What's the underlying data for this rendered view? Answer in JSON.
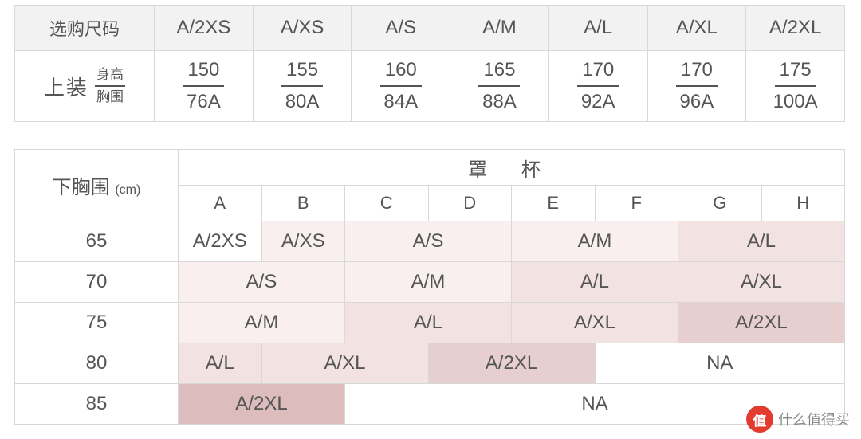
{
  "table1": {
    "header_first": "选购尺码",
    "sizes": [
      "A/2XS",
      "A/XS",
      "A/S",
      "A/M",
      "A/L",
      "A/XL",
      "A/2XL"
    ],
    "row_label_main": "上装",
    "row_label_sub1": "身高",
    "row_label_sub2": "胸围",
    "heights": [
      "150",
      "155",
      "160",
      "165",
      "170",
      "170",
      "175"
    ],
    "busts": [
      "76A",
      "80A",
      "84A",
      "88A",
      "92A",
      "96A",
      "100A"
    ]
  },
  "table2": {
    "row_header_label": "下胸围",
    "row_header_unit": "(cm)",
    "cup_title": "罩 杯",
    "cup_letters": [
      "A",
      "B",
      "C",
      "D",
      "E",
      "F",
      "G",
      "H"
    ],
    "row65": {
      "label": "65",
      "c0": "A/2XS",
      "c1": "A/XS",
      "c2": "A/S",
      "c3": "A/M",
      "c4": "A/L"
    },
    "row70": {
      "label": "70",
      "c0": "A/S",
      "c1": "A/M",
      "c2": "A/L",
      "c3": "A/XL"
    },
    "row75": {
      "label": "75",
      "c0": "A/M",
      "c1": "A/L",
      "c2": "A/XL",
      "c3": "A/2XL"
    },
    "row80": {
      "label": "80",
      "c0": "A/L",
      "c1": "A/XL",
      "c2": "A/2XL",
      "c3": "NA"
    },
    "row85": {
      "label": "85",
      "c0": "A/2XL",
      "c1": "NA"
    }
  },
  "watermark": {
    "badge": "值",
    "text": "什么值得买"
  },
  "chart_data": [
    {
      "type": "table",
      "title": "选购尺码 上装 (身高/胸围)",
      "columns": [
        "选购尺码",
        "A/2XS",
        "A/XS",
        "A/S",
        "A/M",
        "A/L",
        "A/XL",
        "A/2XL"
      ],
      "rows": [
        {
          "metric": "身高",
          "values": [
            150,
            155,
            160,
            165,
            170,
            170,
            175
          ]
        },
        {
          "metric": "胸围",
          "values": [
            "76A",
            "80A",
            "84A",
            "88A",
            "92A",
            "96A",
            "100A"
          ]
        }
      ]
    },
    {
      "type": "table",
      "title": "下胸围(cm) × 罩杯 → 选购尺码",
      "xlabel": "罩杯",
      "ylabel": "下胸围 (cm)",
      "x": [
        "A",
        "B",
        "C",
        "D",
        "E",
        "F",
        "G",
        "H"
      ],
      "y": [
        65,
        70,
        75,
        80,
        85
      ],
      "grid": [
        [
          "A/2XS",
          "A/XS",
          "A/S",
          "A/S",
          "A/M",
          "A/M",
          "A/L",
          "A/L"
        ],
        [
          "A/S",
          "A/S",
          "A/M",
          "A/M",
          "A/L",
          "A/L",
          "A/XL",
          "A/XL"
        ],
        [
          "A/M",
          "A/M",
          "A/L",
          "A/L",
          "A/XL",
          "A/XL",
          "A/2XL",
          "A/2XL"
        ],
        [
          "A/L",
          "A/XL",
          "A/XL",
          "A/2XL",
          "A/2XL",
          "NA",
          "NA",
          "NA"
        ],
        [
          "A/2XL",
          "A/2XL",
          "NA",
          "NA",
          "NA",
          "NA",
          "NA",
          "NA"
        ]
      ]
    }
  ]
}
